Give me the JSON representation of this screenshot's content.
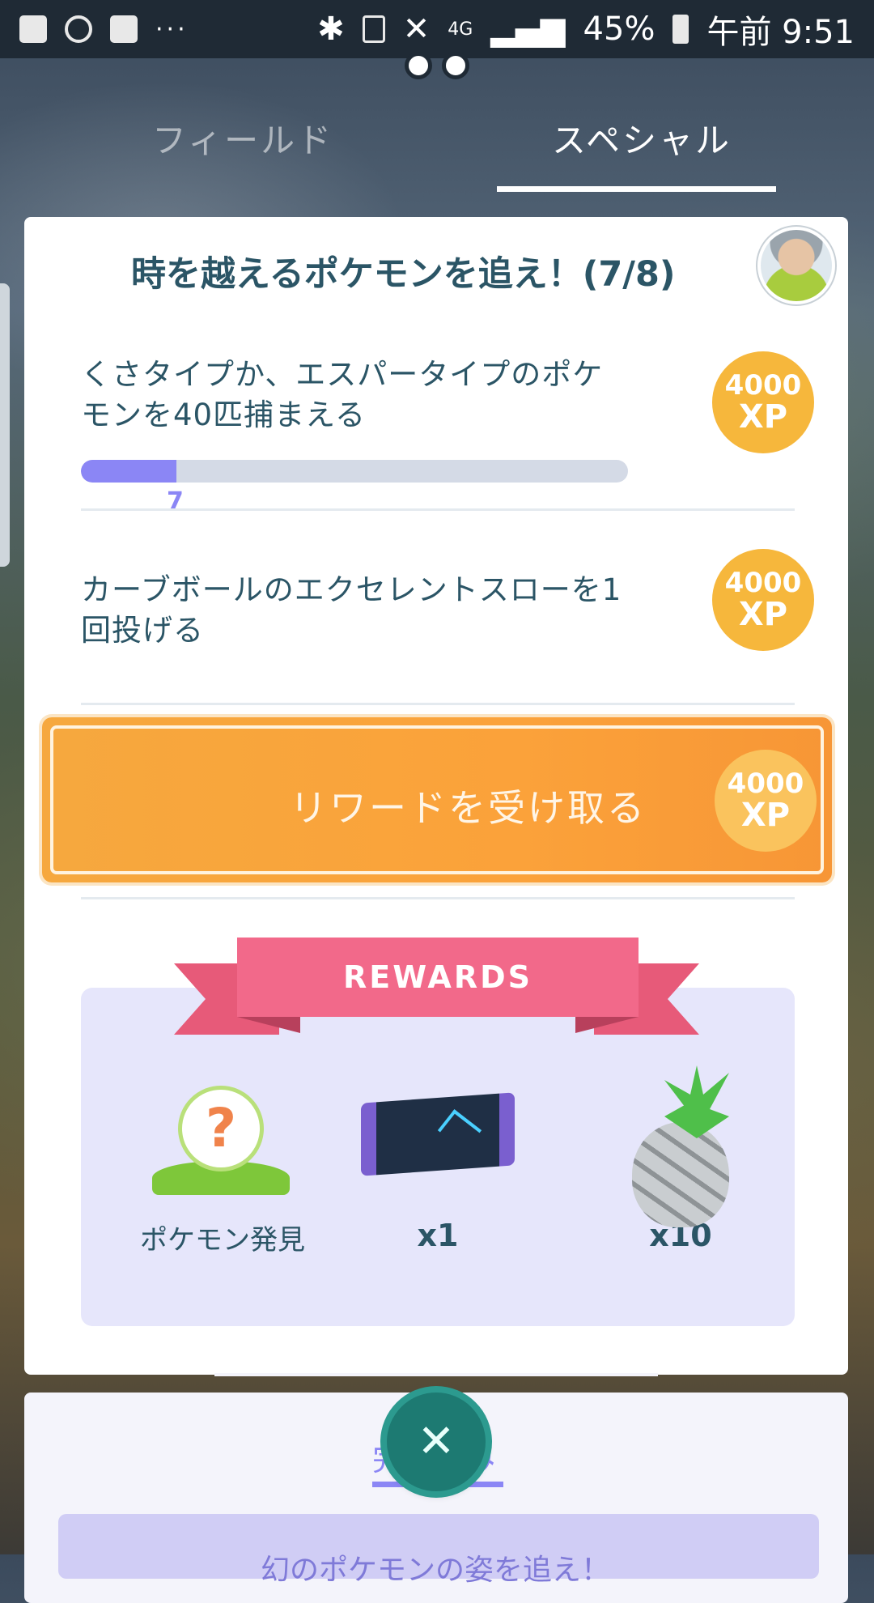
{
  "status_bar": {
    "battery": "45%",
    "time": "午前 9:51",
    "network": "4G",
    "more": "···"
  },
  "tabs": [
    {
      "label": "フィールド",
      "active": false
    },
    {
      "label": "スペシャル",
      "active": true
    }
  ],
  "quest": {
    "title": "時を越えるポケモンを追え！(7/8)",
    "tasks": [
      {
        "text": "くさタイプか、エスパータイプのポケモンを40匹捕まえる",
        "xp_amount": "4000",
        "xp_unit": "XP",
        "progress_value": 7,
        "progress_target": 40,
        "progress_label": "7"
      },
      {
        "text": "カーブボールのエクセレントスローを1回投げる",
        "xp_amount": "4000",
        "xp_unit": "XP"
      }
    ],
    "claim_button": {
      "label": "リワードを受け取る",
      "xp_amount": "4000",
      "xp_unit": "XP"
    },
    "rewards": {
      "heading": "REWARDS",
      "items": [
        {
          "icon": "pokemon-encounter-icon",
          "label": "ポケモン発見"
        },
        {
          "icon": "scroll-icon",
          "label": "x1"
        },
        {
          "icon": "silver-pinap-berry-icon",
          "label": "x10"
        }
      ]
    }
  },
  "bottom": {
    "tab_label": "完了済み",
    "quest_text": "幻のポケモンの姿を追え！"
  },
  "colors": {
    "accent_orange": "#f6a83e",
    "xp_gold": "#f6b73c",
    "progress_purple": "#8b86f5",
    "ribbon_pink": "#f2698a",
    "close_teal": "#1d7a72"
  }
}
